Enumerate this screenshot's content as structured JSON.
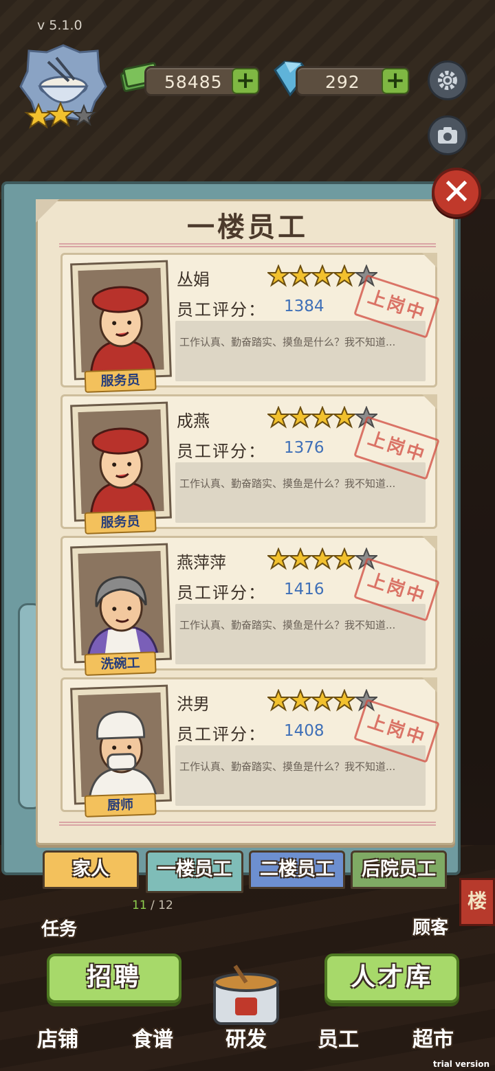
{
  "hud": {
    "version": "v 5.1.0",
    "money": "58485",
    "gems": "292",
    "badge_stars": 2,
    "badge_stars_total": 3
  },
  "panel": {
    "title": "一楼员工",
    "close_symbol": "✕"
  },
  "staff": [
    {
      "name": "丛娟",
      "role": "服务员",
      "stars": 4,
      "stars_total": 5,
      "score_label": "员工评分：",
      "score": "1384",
      "desc": "工作认真、勤奋踏实、摸鱼是什么？我不知道...",
      "stamp": "上岗中"
    },
    {
      "name": "成燕",
      "role": "服务员",
      "stars": 4,
      "stars_total": 5,
      "score_label": "员工评分：",
      "score": "1376",
      "desc": "工作认真、勤奋踏实、摸鱼是什么？我不知道...",
      "stamp": "上岗中"
    },
    {
      "name": "燕萍萍",
      "role": "洗碗工",
      "stars": 4,
      "stars_total": 5,
      "score_label": "员工评分：",
      "score": "1416",
      "desc": "工作认真、勤奋踏实、摸鱼是什么？我不知道...",
      "stamp": "上岗中"
    },
    {
      "name": "洪男",
      "role": "厨师",
      "stars": 4,
      "stars_total": 5,
      "score_label": "员工评分：",
      "score": "1408",
      "desc": "工作认真、勤奋踏实、摸鱼是什么？我不知道...",
      "stamp": "上岗中"
    }
  ],
  "tabs": [
    {
      "label": "家人",
      "color": "#f3c15c",
      "active": false
    },
    {
      "label": "一楼员工",
      "color": "#7fbdb8",
      "active": true
    },
    {
      "label": "二楼员工",
      "color": "#6d8fd0",
      "active": false
    },
    {
      "label": "后院员工",
      "color": "#7faa64",
      "active": false
    }
  ],
  "bottom": {
    "task_label": "任务",
    "progress_current": "11",
    "progress_total": "/ 12",
    "guest_label": "顾客",
    "recruit_button": "招聘",
    "talent_button": "人才库",
    "side_sign": "楼"
  },
  "nav": [
    "店铺",
    "食谱",
    "研发",
    "员工",
    "超市"
  ],
  "watermark": "trial version"
}
